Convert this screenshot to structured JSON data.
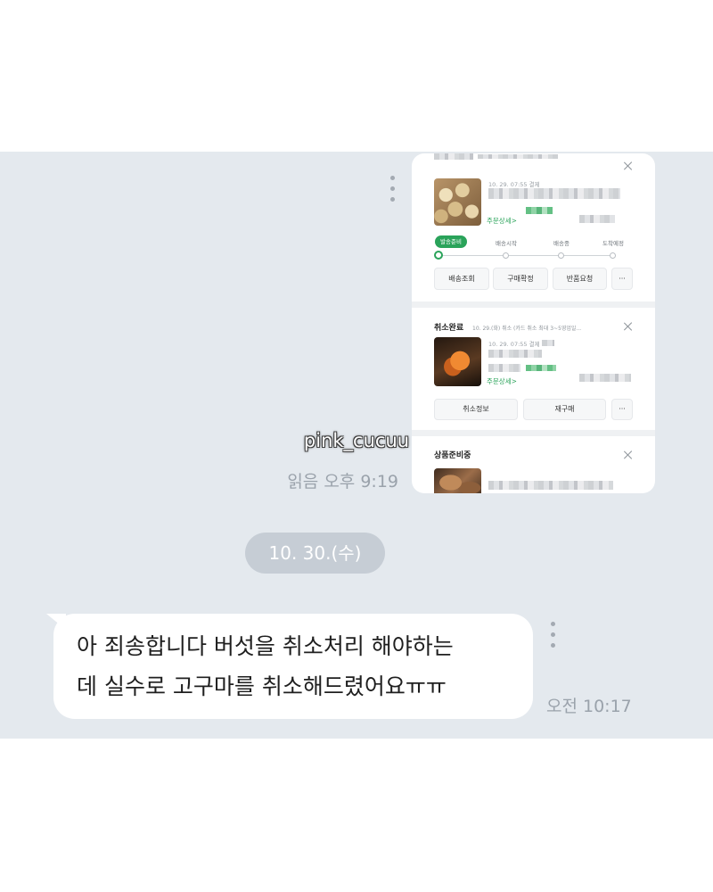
{
  "colors": {
    "chat_bg": "#e4e9ee",
    "bubble": "#ffffff",
    "date_pill": "#c6cdd5",
    "meta_text": "#9aa2ab",
    "accent_green": "#2aa35a",
    "message_text": "#1f1f1f"
  },
  "chat": {
    "shared_screenshot": {
      "card_shipping": {
        "order_date": "10. 29. 07:55 결제",
        "detail_link": "주문상세>",
        "steps": [
          "발송준비",
          "배송시작",
          "배송중",
          "도착예정"
        ],
        "active_step": 0,
        "buttons": [
          "배송조회",
          "구매확정",
          "반품요청",
          "···"
        ]
      },
      "card_cancelled": {
        "status": "취소완료",
        "status_note": "10. 29.(화) 취소 (카드 취소 최대 3~5영업일...",
        "order_date": "10. 29. 07:55 결제",
        "detail_link": "주문상세>",
        "buttons": [
          "취소정보",
          "재구매",
          "···"
        ]
      },
      "card_preparing": {
        "status": "상품준비중"
      }
    },
    "watermark": "pink_cucuu",
    "read_receipt": "읽음 오후 9:19",
    "date_divider": "10. 30.(수)",
    "received_message": {
      "lines": [
        "아 죄송합니다 버섯을 취소처리 해야하는",
        "데 실수로 고구마를 취소해드렸어요ㅠㅠ"
      ],
      "time": "오전 10:17"
    }
  }
}
